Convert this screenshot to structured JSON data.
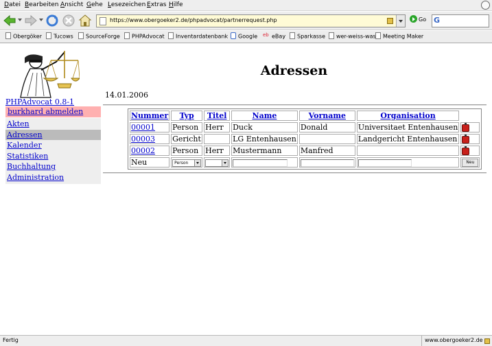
{
  "browser": {
    "menu": [
      {
        "prefix": "",
        "hotkey": "D",
        "rest": "atei"
      },
      {
        "prefix": "",
        "hotkey": "B",
        "rest": "earbeiten"
      },
      {
        "prefix": "",
        "hotkey": "A",
        "rest": "nsicht"
      },
      {
        "prefix": "",
        "hotkey": "G",
        "rest": "ehe"
      },
      {
        "prefix": "",
        "hotkey": "L",
        "rest": "esezeichen"
      },
      {
        "prefix": "",
        "hotkey": "E",
        "rest": "xtras"
      },
      {
        "prefix": "",
        "hotkey": "H",
        "rest": "ilfe"
      }
    ],
    "url": "https://www.obergoeker2.de/phpadvocat/partnerrequest.php",
    "go_label": "Go",
    "search_engine_letter": "G",
    "bookmarks": [
      {
        "label": "Obergöker",
        "icon": "page-icon"
      },
      {
        "label": "Tucows",
        "icon": "page-icon"
      },
      {
        "label": "SourceForge",
        "icon": "page-icon"
      },
      {
        "label": "PHPAdvocat",
        "icon": "page-icon"
      },
      {
        "label": "Inventardatenbank",
        "icon": "page-icon"
      },
      {
        "label": "Google",
        "icon": "google-icon"
      },
      {
        "label": "eBay",
        "icon": "ebay-icon"
      },
      {
        "label": "Sparkasse",
        "icon": "page-icon"
      },
      {
        "label": "wer-weiss-was",
        "icon": "page-icon"
      },
      {
        "label": "Meeting Maker",
        "icon": "page-icon"
      }
    ],
    "status_text": "Fertig",
    "status_host": "www.obergoeker2.de"
  },
  "app": {
    "version": "PHPAdvocat 0.8-1",
    "logout_label": "burkhard abmelden",
    "nav": [
      {
        "label": "Akten",
        "active": false
      },
      {
        "label": "Adressen",
        "active": true
      },
      {
        "label": "Kalender",
        "active": false
      },
      {
        "label": "Statistiken",
        "active": false
      },
      {
        "label": "Buchhaltung",
        "active": false
      },
      {
        "label": "Administration",
        "active": false
      }
    ]
  },
  "page": {
    "title": "Adressen",
    "date": "14.01.2006"
  },
  "table": {
    "headers": [
      "Nummer",
      "Typ",
      "Titel",
      "Name",
      "Vorname",
      "Organisation"
    ],
    "rows": [
      {
        "nummer": "00001",
        "typ": "Person",
        "titel": "Herr",
        "name": "Duck",
        "vorname": "Donald",
        "organisation": "Universitaet Entenhausen"
      },
      {
        "nummer": "00003",
        "typ": "Gericht",
        "titel": "",
        "name": "LG Entenhausen",
        "vorname": "",
        "organisation": "Landgericht Entenhausen"
      },
      {
        "nummer": "00002",
        "typ": "Person",
        "titel": "Herr",
        "name": "Mustermann",
        "vorname": "Manfred",
        "organisation": ""
      }
    ],
    "new_row": {
      "label": "Neu",
      "typ_selected": "Person",
      "titel_selected": "",
      "button_label": "Neu"
    }
  }
}
